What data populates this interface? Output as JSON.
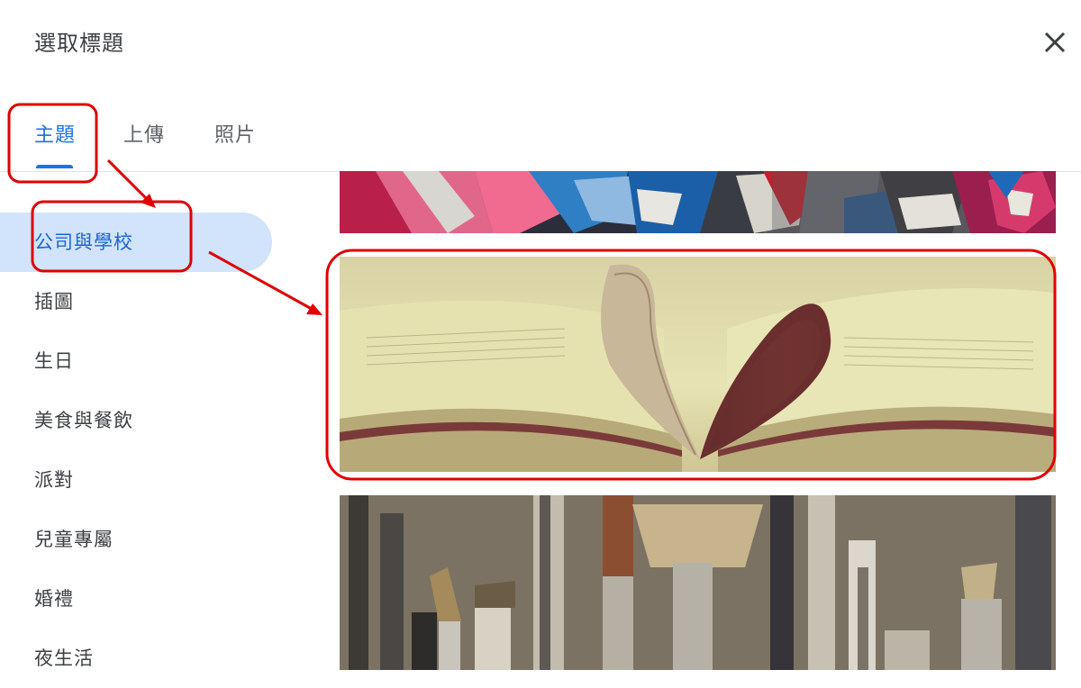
{
  "dialog": {
    "title": "選取標題",
    "close_icon": "close-icon"
  },
  "tabs": [
    {
      "label": "主題",
      "active": true
    },
    {
      "label": "上傳",
      "active": false
    },
    {
      "label": "照片",
      "active": false
    }
  ],
  "sidebar": {
    "items": [
      {
        "label": "公司與學校",
        "active": true
      },
      {
        "label": "插圖"
      },
      {
        "label": "生日"
      },
      {
        "label": "美食與餐飲"
      },
      {
        "label": "派對"
      },
      {
        "label": "兒童專屬"
      },
      {
        "label": "婚禮"
      },
      {
        "label": "夜生活"
      }
    ]
  },
  "gallery": {
    "themes": [
      {
        "image": "paint-splatter-image"
      },
      {
        "image": "heart-book-image"
      },
      {
        "image": "paintbrushes-image"
      }
    ]
  },
  "colors": {
    "accent": "#1a73e8",
    "active_bg": "#d2e3fc",
    "annotation": "#e00000"
  }
}
